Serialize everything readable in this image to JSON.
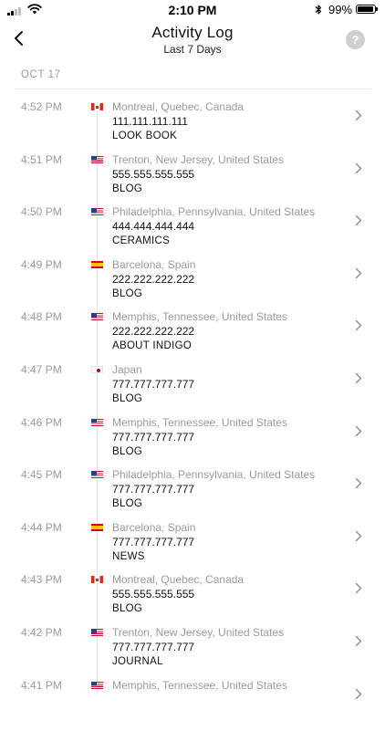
{
  "status_bar": {
    "time": "2:10 PM",
    "battery_percent": "99%",
    "battery_level": 0.99,
    "icons": [
      "cellular-signal-icon",
      "wifi-icon",
      "bluetooth-icon",
      "battery-icon"
    ]
  },
  "header": {
    "title": "Activity Log",
    "subtitle": "Last 7 Days",
    "help_label": "?",
    "back_icon": "chevron-left-icon"
  },
  "section": {
    "date": "OCT 17"
  },
  "colors": {
    "muted_text": "#9a9a9a",
    "primary_text": "#111111",
    "help_button": "#cfcfcf",
    "timeline": "#e3e3e3"
  },
  "entries": [
    {
      "time": "4:52 PM",
      "flag": "ca",
      "location": "Montreal, Quebec, Canada",
      "ip": "111.111.111.111",
      "page": "LOOK BOOK"
    },
    {
      "time": "4:51 PM",
      "flag": "us",
      "location": "Trenton, New Jersey, United States",
      "ip": "555.555.555.555",
      "page": "BLOG"
    },
    {
      "time": "4:50 PM",
      "flag": "us",
      "location": "Philadelphia, Pennsylvania, United States",
      "ip": "444.444.444.444",
      "page": "CERAMICS"
    },
    {
      "time": "4:49 PM",
      "flag": "es",
      "location": "Barcelona, Spain",
      "ip": "222.222.222.222",
      "page": "BLOG"
    },
    {
      "time": "4:48 PM",
      "flag": "us",
      "location": "Memphis, Tennessee, United States",
      "ip": "222.222.222.222",
      "page": "ABOUT INDIGO"
    },
    {
      "time": "4:47 PM",
      "flag": "jp",
      "location": "Japan",
      "ip": "777.777.777.777",
      "page": "BLOG"
    },
    {
      "time": "4:46 PM",
      "flag": "us",
      "location": "Memphis, Tennessee, United States",
      "ip": "777.777.777.777",
      "page": "BLOG"
    },
    {
      "time": "4:45 PM",
      "flag": "us",
      "location": "Philadelphia, Pennsylvania, United States",
      "ip": "777.777.777.777",
      "page": "BLOG"
    },
    {
      "time": "4:44 PM",
      "flag": "es",
      "location": "Barcelona, Spain",
      "ip": "777.777.777.777",
      "page": "NEWS"
    },
    {
      "time": "4:43 PM",
      "flag": "ca",
      "location": "Montreal, Quebec, Canada",
      "ip": "555.555.555.555",
      "page": "BLOG"
    },
    {
      "time": "4:42 PM",
      "flag": "us",
      "location": "Trenton, New Jersey, United States",
      "ip": "777.777.777.777",
      "page": "JOURNAL"
    },
    {
      "time": "4:41 PM",
      "flag": "us",
      "location": "Memphis, Tennessee, United States",
      "ip": "",
      "page": ""
    }
  ]
}
